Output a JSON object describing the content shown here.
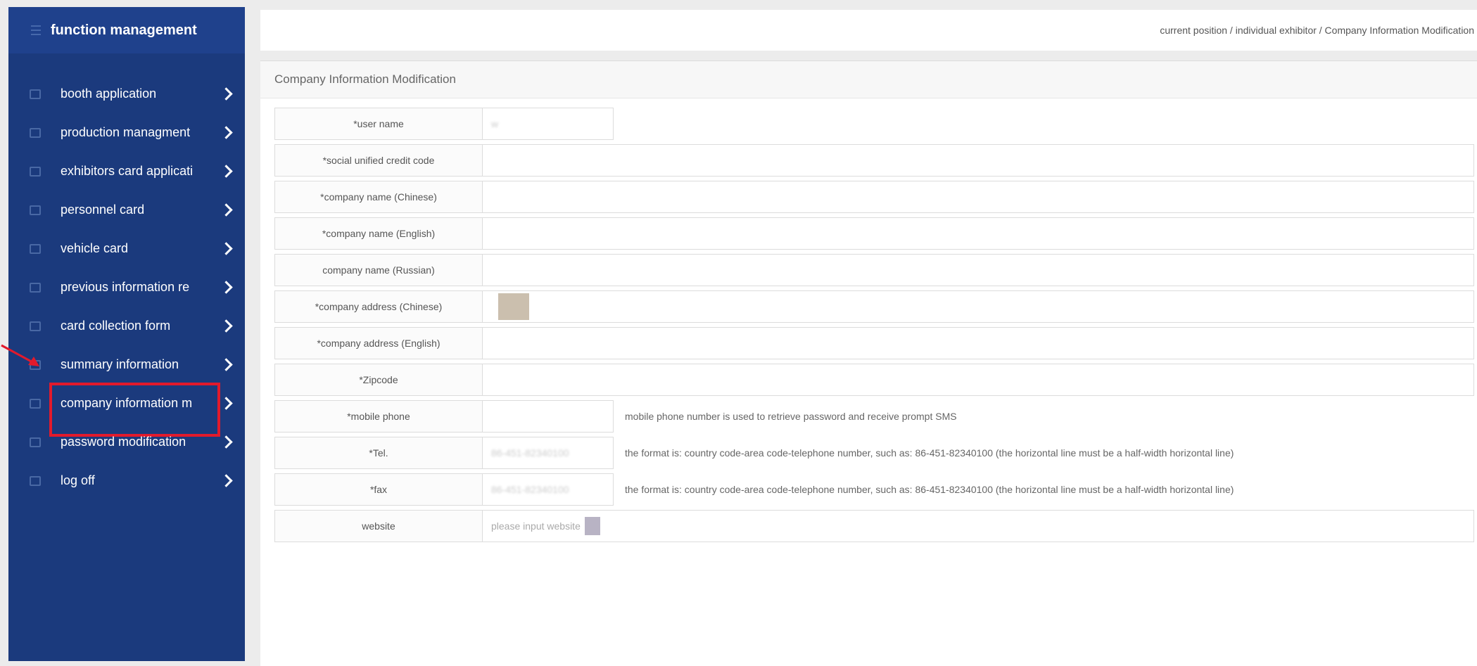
{
  "sidebar": {
    "title": "function management",
    "items": [
      {
        "label": "booth application"
      },
      {
        "label": "production managment"
      },
      {
        "label": "exhibitors card applicati"
      },
      {
        "label": "personnel card"
      },
      {
        "label": "vehicle card"
      },
      {
        "label": "previous information re"
      },
      {
        "label": "card collection form"
      },
      {
        "label": "summary information"
      },
      {
        "label": "company information m"
      },
      {
        "label": "password modification"
      },
      {
        "label": "log off"
      }
    ],
    "highlighted_item": "company information m"
  },
  "breadcrumb": "current position / individual exhibitor / Company Information Modification",
  "panel": {
    "title": "Company Information Modification",
    "rows": [
      {
        "label": "*user name",
        "value": "w"
      },
      {
        "label": "*social unified credit code",
        "value": ""
      },
      {
        "label": "*company name (Chinese)",
        "value": ""
      },
      {
        "label": "*company name (English)",
        "value": ""
      },
      {
        "label": "company name (Russian)",
        "value": ""
      },
      {
        "label": "*company address (Chinese)",
        "value": ""
      },
      {
        "label": "*company address (English)",
        "value": ""
      },
      {
        "label": "*Zipcode",
        "value": ""
      },
      {
        "label": "*mobile phone",
        "value": "",
        "hint": "mobile phone number is used to retrieve password and receive prompt SMS"
      },
      {
        "label": "*Tel.",
        "value": "86-451-82340100",
        "hint": "the format is: country code-area code-telephone number, such as: 86-451-82340100 (the horizontal line must be a half-width horizontal line)"
      },
      {
        "label": "*fax",
        "value": "86-451-82340100",
        "hint": "the format is: country code-area code-telephone number, such as: 86-451-82340100 (the horizontal line must be a half-width horizontal line)"
      },
      {
        "label": "website",
        "placeholder": "please input website"
      }
    ]
  }
}
